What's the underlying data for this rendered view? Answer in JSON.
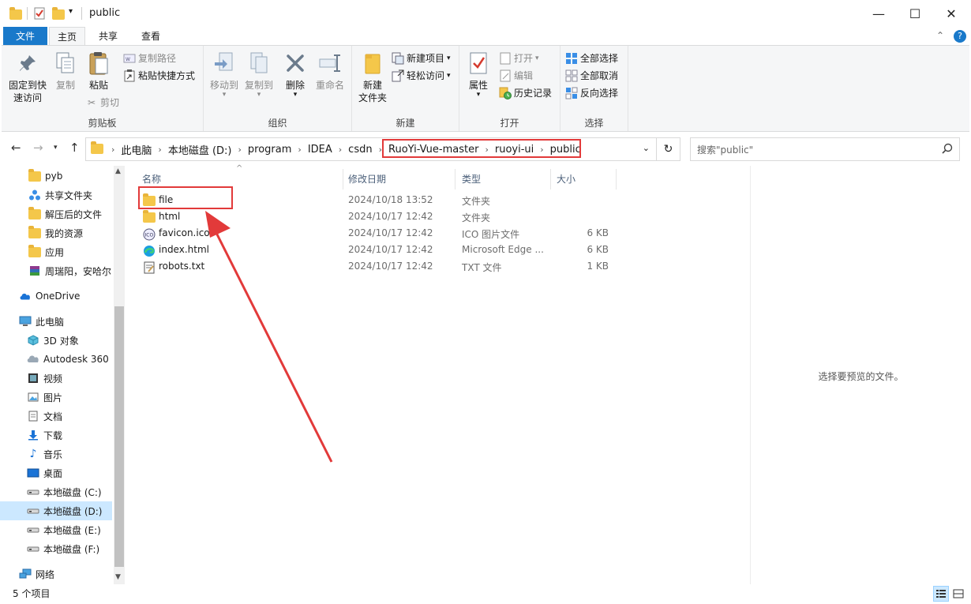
{
  "window": {
    "title": "public",
    "controls": {
      "minimize": "—",
      "maximize": "☐",
      "close": "✕"
    }
  },
  "tabs": [
    {
      "label": "文件"
    },
    {
      "label": "主页"
    },
    {
      "label": "共享"
    },
    {
      "label": "查看"
    }
  ],
  "ribbon": {
    "clipboard": {
      "label": "剪贴板",
      "pin": "固定到快\n速访问",
      "copy": "复制",
      "paste": "粘贴",
      "copy_path": "复制路径",
      "paste_shortcut": "粘贴快捷方式",
      "cut": "剪切"
    },
    "organize": {
      "label": "组织",
      "move_to": "移动到",
      "copy_to": "复制到",
      "delete": "删除",
      "rename": "重命名"
    },
    "new": {
      "label": "新建",
      "new_folder": "新建\n文件夹",
      "new_item": "新建项目",
      "easy_access": "轻松访问"
    },
    "open": {
      "label": "打开",
      "properties": "属性",
      "open": "打开",
      "edit": "编辑",
      "history": "历史记录"
    },
    "select": {
      "label": "选择",
      "select_all": "全部选择",
      "select_none": "全部取消",
      "invert": "反向选择"
    }
  },
  "address": {
    "crumbs": [
      "此电脑",
      "本地磁盘 (D:)",
      "program",
      "IDEA",
      "csdn",
      "RuoYi-Vue-master",
      "ruoyi-ui",
      "public"
    ]
  },
  "search": {
    "placeholder": "搜索\"public\""
  },
  "nav": [
    {
      "label": "pyb",
      "icon": "folder"
    },
    {
      "label": "共享文件夹",
      "icon": "share"
    },
    {
      "label": "解压后的文件",
      "icon": "folder"
    },
    {
      "label": "我的资源",
      "icon": "folder"
    },
    {
      "label": "应用",
      "icon": "folder"
    },
    {
      "label": "周瑞阳，安哈尔",
      "icon": "winrar"
    },
    {
      "label": "OneDrive",
      "icon": "cloud"
    },
    {
      "label": "此电脑",
      "icon": "pc"
    },
    {
      "label": "3D 对象",
      "icon": "cube"
    },
    {
      "label": "Autodesk 360",
      "icon": "autodesk"
    },
    {
      "label": "视频",
      "icon": "video"
    },
    {
      "label": "图片",
      "icon": "picture"
    },
    {
      "label": "文档",
      "icon": "document"
    },
    {
      "label": "下载",
      "icon": "download"
    },
    {
      "label": "音乐",
      "icon": "music"
    },
    {
      "label": "桌面",
      "icon": "desktop"
    },
    {
      "label": "本地磁盘 (C:)",
      "icon": "drive"
    },
    {
      "label": "本地磁盘 (D:)",
      "icon": "drive"
    },
    {
      "label": "本地磁盘 (E:)",
      "icon": "drive"
    },
    {
      "label": "本地磁盘 (F:)",
      "icon": "drive"
    },
    {
      "label": "网络",
      "icon": "network"
    }
  ],
  "columns": {
    "name": "名称",
    "date": "修改日期",
    "type": "类型",
    "size": "大小"
  },
  "files": [
    {
      "name": "file",
      "date": "2024/10/18 13:52",
      "type": "文件夹",
      "size": "",
      "icon": "folder"
    },
    {
      "name": "html",
      "date": "2024/10/17 12:42",
      "type": "文件夹",
      "size": "",
      "icon": "folder"
    },
    {
      "name": "favicon.ico",
      "date": "2024/10/17 12:42",
      "type": "ICO 图片文件",
      "size": "6 KB",
      "icon": "ico"
    },
    {
      "name": "index.html",
      "date": "2024/10/17 12:42",
      "type": "Microsoft Edge ...",
      "size": "6 KB",
      "icon": "edge"
    },
    {
      "name": "robots.txt",
      "date": "2024/10/17 12:42",
      "type": "TXT 文件",
      "size": "1 KB",
      "icon": "txt"
    }
  ],
  "preview": {
    "message": "选择要预览的文件。"
  },
  "status": {
    "count": "5 个项目"
  },
  "colors": {
    "accent": "#1979ca",
    "highlight": "#e23a3a",
    "folder": "#f4c74a",
    "selected": "#cce8ff"
  }
}
